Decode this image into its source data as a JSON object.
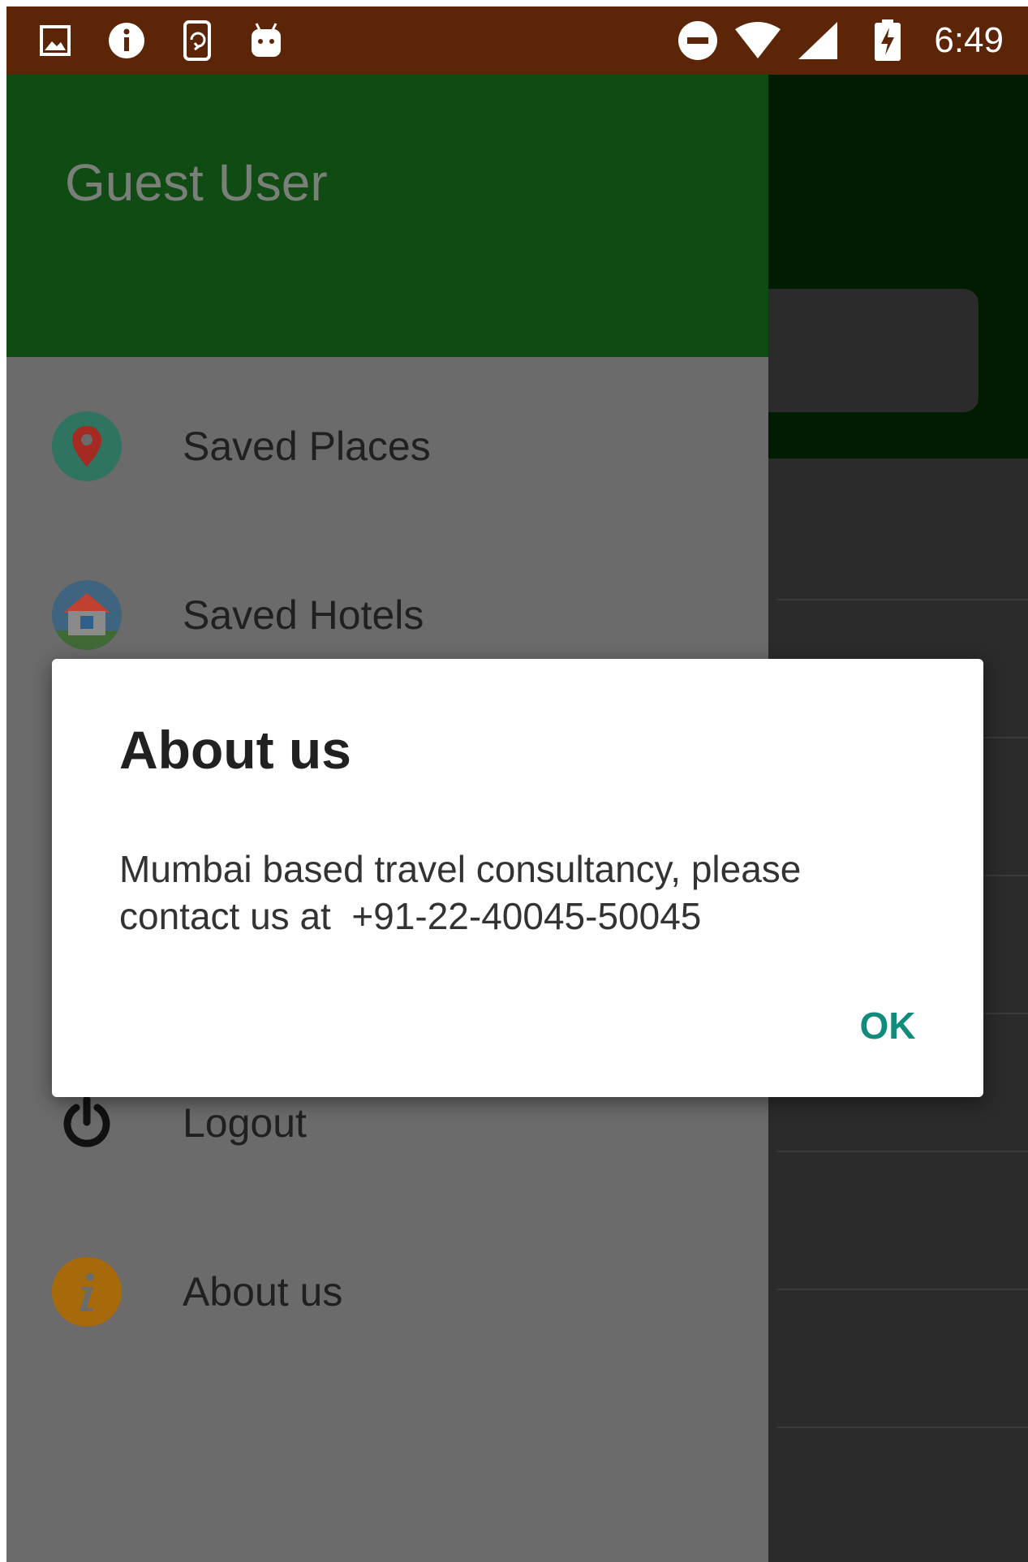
{
  "status_bar": {
    "time": "6:49",
    "background_color": "#5c2508",
    "left_icons": [
      "image-notification-icon",
      "info-notification-icon",
      "phone-rotate-icon",
      "android-debug-icon"
    ],
    "right_icons": [
      "do-not-disturb-icon",
      "wifi-icon",
      "cellular-signal-icon",
      "battery-charging-icon"
    ]
  },
  "drawer": {
    "user_name": "Guest User",
    "header_color": "#0f4b12",
    "items": [
      {
        "label": "Saved Places",
        "icon": "location-pin-icon"
      },
      {
        "label": "Saved Hotels",
        "icon": "hotel-house-icon"
      },
      {
        "label": "Logout",
        "icon": "power-icon"
      },
      {
        "label": "About us",
        "icon": "info-icon"
      }
    ]
  },
  "dialog": {
    "title": "About us",
    "message": "Mumbai based travel consultancy, please contact us at  +91-22-40045-50045",
    "ok_label": "OK",
    "accent_color": "#118c7c"
  }
}
